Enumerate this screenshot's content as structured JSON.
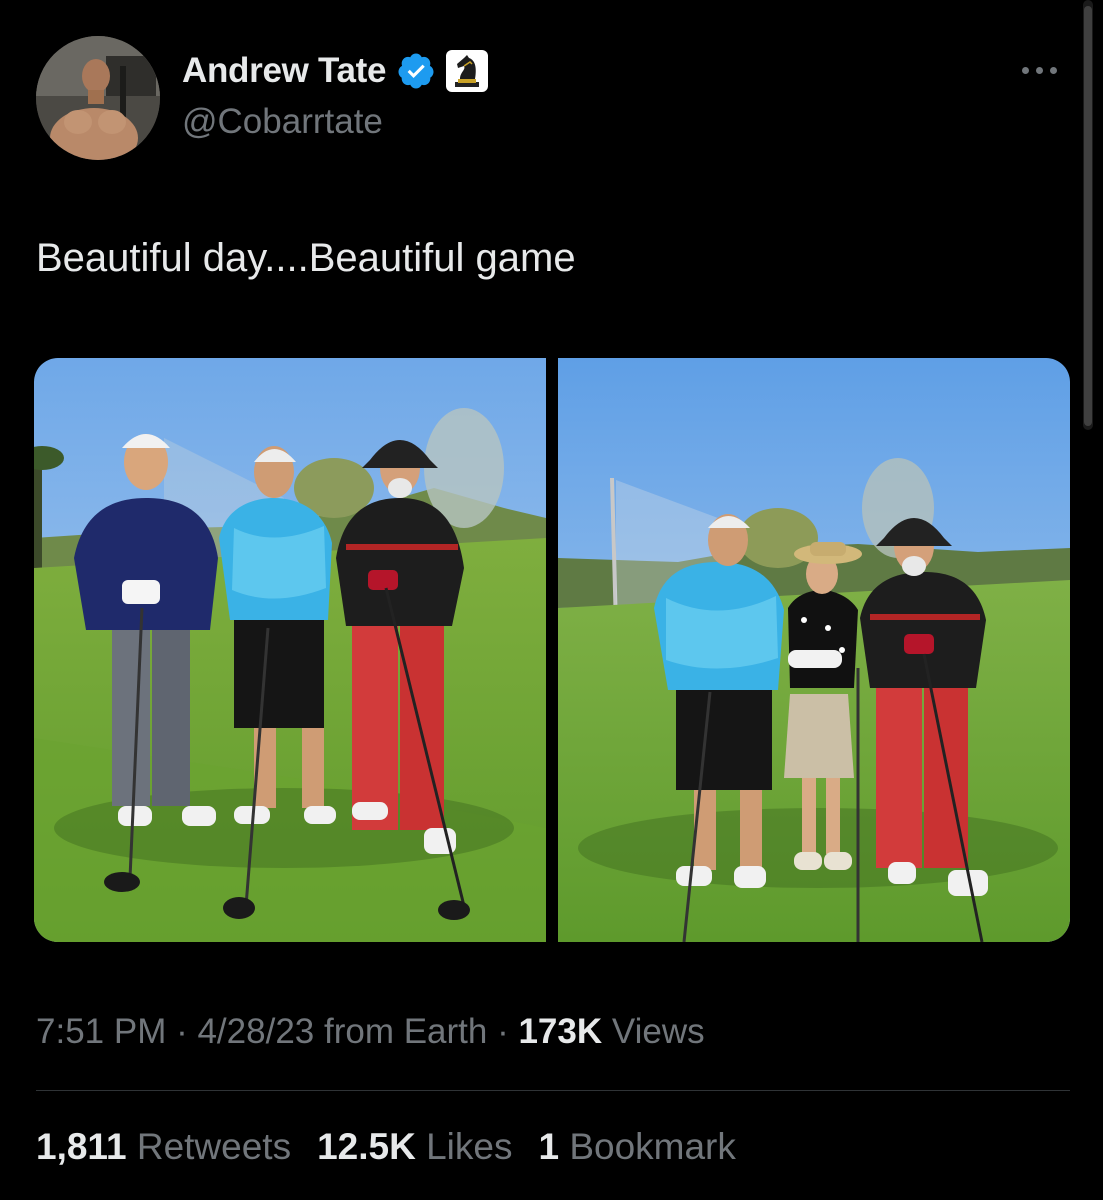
{
  "author": {
    "name": "Andrew Tate",
    "handle": "@Cobarrtate",
    "verified_icon": "verified-badge-icon",
    "affiliation_icon": "chess-knight-icon"
  },
  "menu_icon": "more-options-icon",
  "tweet": {
    "text": "Beautiful day....Beautiful game"
  },
  "media": [
    {
      "kind": "photo",
      "subject": "golf-course-group-photo-3"
    },
    {
      "kind": "photo",
      "subject": "golf-course-group-photo-4"
    }
  ],
  "meta": {
    "time": "7:51 PM",
    "sep1": " · ",
    "date": "4/28/23",
    "source": " from Earth",
    "sep2": " · ",
    "views_count": "173K",
    "views_label": " Views"
  },
  "stats": [
    {
      "count": "1,811",
      "label": " Retweets"
    },
    {
      "count": "12.5K",
      "label": " Likes"
    },
    {
      "count": "1",
      "label": " Bookmark"
    }
  ],
  "colors": {
    "background": "#000000",
    "text_primary": "#e7e9ea",
    "text_secondary": "#71767b",
    "verified_blue": "#1d9bf0",
    "divider": "#2f3336"
  }
}
